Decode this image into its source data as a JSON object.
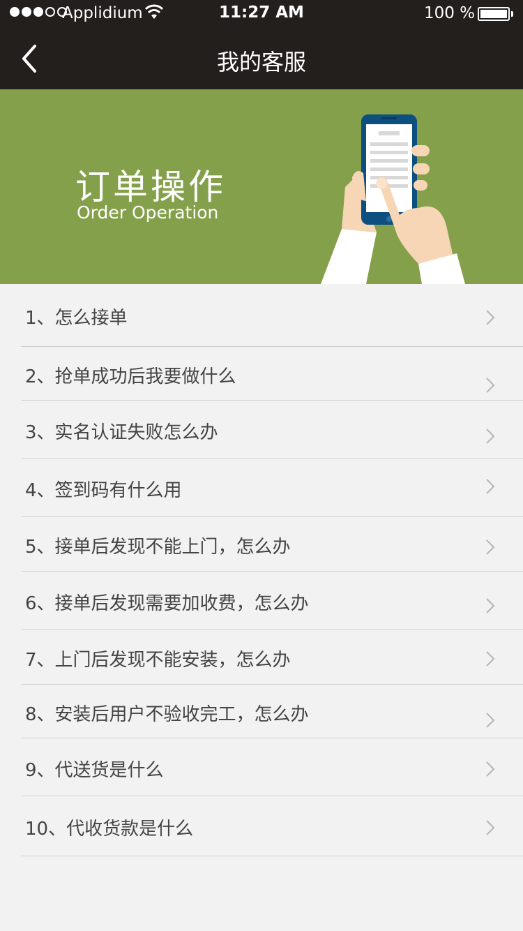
{
  "status_bar": {
    "carrier": "Applidium",
    "time": "11:27 AM",
    "battery_percent": "100 %",
    "signal_bars_filled": 3,
    "signal_bars_total": 5,
    "battery_level": 1.0
  },
  "nav": {
    "title": "我的客服",
    "back_icon": "chevron-left-icon"
  },
  "banner": {
    "title": "订单操作",
    "subtitle": "Order Operation",
    "background_color": "#84a04b",
    "illustration": "hand-holding-phone-illustration"
  },
  "faq": {
    "items": [
      {
        "label": "1、怎么接单"
      },
      {
        "label": "2、抢单成功后我要做什么"
      },
      {
        "label": "3、实名认证失败怎么办"
      },
      {
        "label": "4、签到码有什么用"
      },
      {
        "label": "5、接单后发现不能上门，怎么办"
      },
      {
        "label": "6、接单后发现需要加收费，怎么办"
      },
      {
        "label": "7、上门后发现不能安装，怎么办"
      },
      {
        "label": "8、安装后用户不验收完工，怎么办"
      },
      {
        "label": "9、代送货是什么"
      },
      {
        "label": "10、代收货款是什么"
      }
    ],
    "chevron_icon": "chevron-right-icon"
  },
  "colors": {
    "header": "#231f1c",
    "banner": "#84a04b",
    "list_background": "#f2f2f2",
    "divider": "#cfcfcf",
    "text": "#444444"
  }
}
